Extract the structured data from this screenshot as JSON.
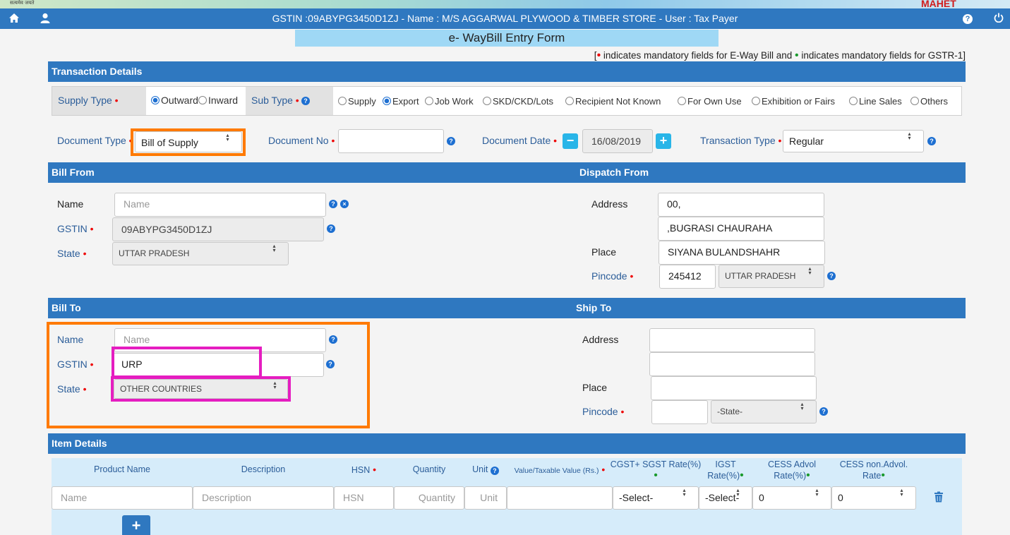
{
  "header": {
    "banner_text": "सत्यमेव जयते",
    "brand_text": "MAHET",
    "title": "GSTIN :09ABYPG3450D1ZJ - Name : M/S AGGARWAL PLYWOOD & TIMBER STORE - User : Tax Payer"
  },
  "form_title": "e- WayBill Entry Form",
  "legend": {
    "open": "[",
    "red_text": " indicates mandatory fields for E-Way Bill and ",
    "green_text": " indicates mandatory fields for GSTR-1]"
  },
  "transaction": {
    "header": "Transaction Details",
    "supply_type_label": "Supply Type",
    "supply_options": [
      "Outward",
      "Inward"
    ],
    "supply_selected": "Outward",
    "sub_type_label": "Sub Type",
    "sub_options": [
      "Supply",
      "Export",
      "Job Work",
      "SKD/CKD/Lots",
      "Recipient Not Known",
      "For Own Use",
      "Exhibition or Fairs",
      "Line Sales",
      "Others"
    ],
    "sub_selected": "Export",
    "doc_type_label": "Document Type",
    "doc_type_value": "Bill of Supply",
    "doc_no_label": "Document No",
    "doc_no_value": "",
    "doc_date_label": "Document Date",
    "doc_date_value": "16/08/2019",
    "trans_type_label": "Transaction Type",
    "trans_type_value": "Regular"
  },
  "bill_from": {
    "header": "Bill From",
    "name_label": "Name",
    "name_placeholder": "Name",
    "gstin_label": "GSTIN",
    "gstin_value": "09ABYPG3450D1ZJ",
    "state_label": "State",
    "state_value": "UTTAR PRADESH"
  },
  "dispatch_from": {
    "header": "Dispatch From",
    "address_label": "Address",
    "address1": "00,",
    "address2": ",BUGRASI CHAURAHA",
    "place_label": "Place",
    "place_value": "SIYANA BULANDSHAHR",
    "pincode_label": "Pincode",
    "pincode_value": "245412",
    "state_value": "UTTAR PRADESH"
  },
  "bill_to": {
    "header": "Bill To",
    "name_label": "Name",
    "name_placeholder": "Name",
    "gstin_label": "GSTIN",
    "gstin_value": "URP",
    "state_label": "State",
    "state_value": "OTHER COUNTRIES"
  },
  "ship_to": {
    "header": "Ship To",
    "address_label": "Address",
    "place_label": "Place",
    "pincode_label": "Pincode",
    "state_value": "-State-"
  },
  "items": {
    "header": "Item Details",
    "columns": {
      "product": "Product Name",
      "description": "Description",
      "hsn": "HSN",
      "quantity": "Quantity",
      "unit": "Unit",
      "value": "Value/Taxable Value (Rs.)",
      "cgst_sgst": "CGST+ SGST Rate(%)",
      "igst_1": "IGST",
      "igst_2": "Rate(%)",
      "cess_advol_1": "CESS Advol",
      "cess_advol_2": "Rate(%)",
      "cess_nonadvol_1": "CESS non.Advol.",
      "cess_nonadvol_2": "Rate"
    },
    "row": {
      "product_placeholder": "Name",
      "description_placeholder": "Description",
      "hsn_placeholder": "HSN",
      "quantity_placeholder": "Quantity",
      "unit_placeholder": "Unit",
      "cgst_value": "-Select-",
      "igst_value": "-Select-",
      "cess_advol_value": "0",
      "cess_nonadvol_value": "0"
    },
    "add_label": "+"
  }
}
